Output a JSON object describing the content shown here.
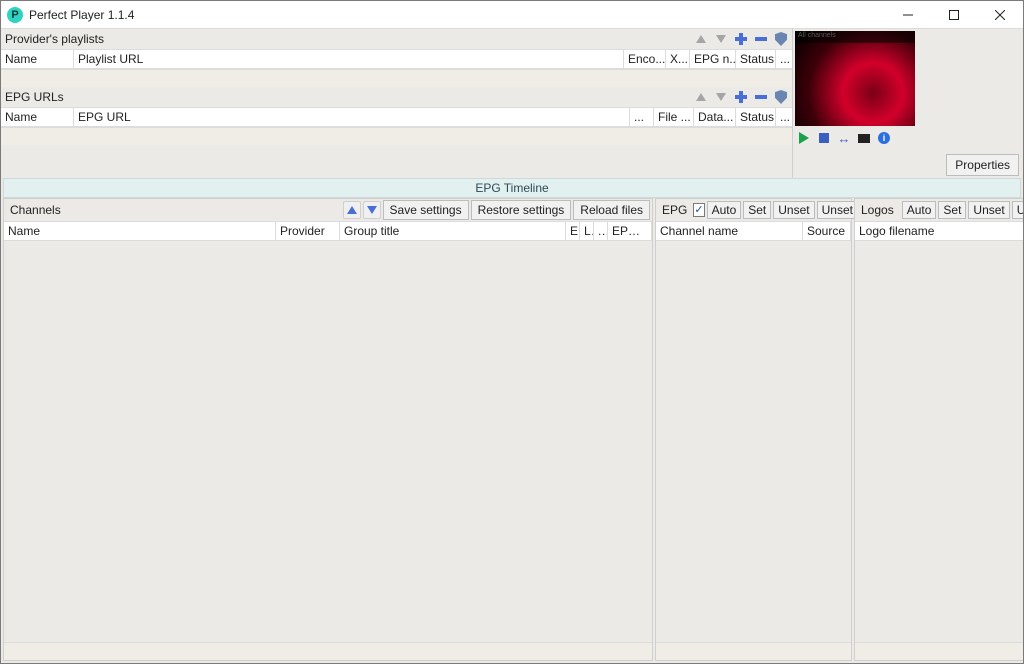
{
  "titlebar": {
    "title": "Perfect Player 1.1.4"
  },
  "playlists": {
    "header": "Provider's playlists",
    "cols": {
      "name": "Name",
      "url": "Playlist URL",
      "enco": "Enco...",
      "x": "X...",
      "epg": "EPG n...",
      "status": "Status",
      "more": "..."
    }
  },
  "epgurls": {
    "header": "EPG URLs",
    "cols": {
      "name": "Name",
      "url": "EPG URL",
      "more1": "...",
      "file": "File ...",
      "data": "Data...",
      "status": "Status",
      "more2": "..."
    }
  },
  "preview": {
    "caption": "All channels"
  },
  "properties_btn": "Properties",
  "timeline": "EPG Timeline",
  "channels": {
    "label": "Channels",
    "save": "Save settings",
    "restore": "Restore settings",
    "reload": "Reload files",
    "cols": {
      "name": "Name",
      "provider": "Provider",
      "group": "Group title",
      "e": "E",
      "l": "L",
      "dots": "...",
      "epg": "EPG ..."
    }
  },
  "epg_panel": {
    "label": "EPG",
    "auto": "Auto",
    "set": "Set",
    "unset": "Unset",
    "unsetall": "Unset all",
    "cols": {
      "chname": "Channel name",
      "source": "Source"
    }
  },
  "logos_panel": {
    "label": "Logos",
    "auto": "Auto",
    "set": "Set",
    "unset": "Unset",
    "unsetall": "Unset all",
    "cols": {
      "fname": "Logo filename"
    }
  }
}
